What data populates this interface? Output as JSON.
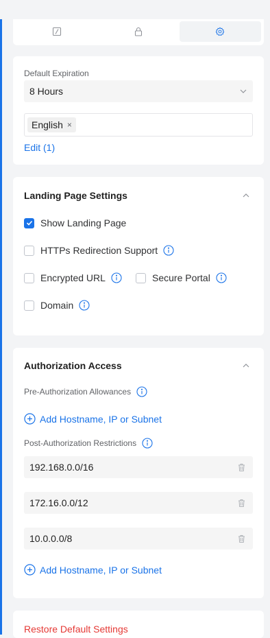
{
  "tabs": [
    {
      "icon": "edit-icon"
    },
    {
      "icon": "lock-icon"
    },
    {
      "icon": "gear-icon",
      "active": true
    }
  ],
  "general": {
    "expiration_label": "Default Expiration",
    "expiration_value": "8 Hours",
    "language_tag": "English",
    "edit_link": "Edit (1)"
  },
  "landing": {
    "title": "Landing Page Settings",
    "options": {
      "show_landing": {
        "label": "Show Landing Page",
        "checked": true
      },
      "https_redirect": {
        "label": "HTTPs Redirection Support",
        "checked": false
      },
      "encrypted_url": {
        "label": "Encrypted URL",
        "checked": false
      },
      "secure_portal": {
        "label": "Secure Portal",
        "checked": false
      },
      "domain": {
        "label": "Domain",
        "checked": false
      }
    }
  },
  "auth": {
    "title": "Authorization Access",
    "pre_label": "Pre-Authorization Allowances",
    "add_label": "Add Hostname, IP or Subnet",
    "post_label": "Post-Authorization Restrictions",
    "restrictions": [
      "192.168.0.0/16",
      "172.16.0.0/12",
      "10.0.0.0/8"
    ]
  },
  "footer": {
    "restore_label": "Restore Default Settings"
  },
  "colors": {
    "accent": "#1a73e8",
    "danger": "#e53935"
  }
}
